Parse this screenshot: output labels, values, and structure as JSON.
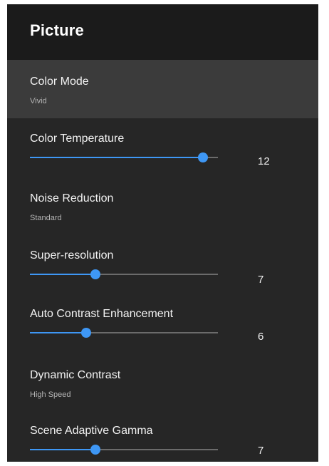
{
  "header": {
    "title": "Picture"
  },
  "items": [
    {
      "type": "option",
      "title": "Color Mode",
      "value": "Vivid",
      "selected": true
    },
    {
      "type": "slider",
      "title": "Color Temperature",
      "value": "12",
      "fill_fraction": 0.92
    },
    {
      "type": "option",
      "title": "Noise Reduction",
      "value": "Standard"
    },
    {
      "type": "slider",
      "title": "Super-resolution",
      "value": "7",
      "fill_fraction": 0.35
    },
    {
      "type": "slider",
      "title": "Auto Contrast Enhancement",
      "value": "6",
      "fill_fraction": 0.3
    },
    {
      "type": "option",
      "title": "Dynamic Contrast",
      "value": "High Speed"
    },
    {
      "type": "slider",
      "title": "Scene Adaptive Gamma",
      "value": "7",
      "fill_fraction": 0.35
    }
  ],
  "colors": {
    "accent": "#3e97f5",
    "panel_background": "#262626",
    "header_background": "#1b1b1b",
    "selected_background": "#3b3b3b"
  }
}
